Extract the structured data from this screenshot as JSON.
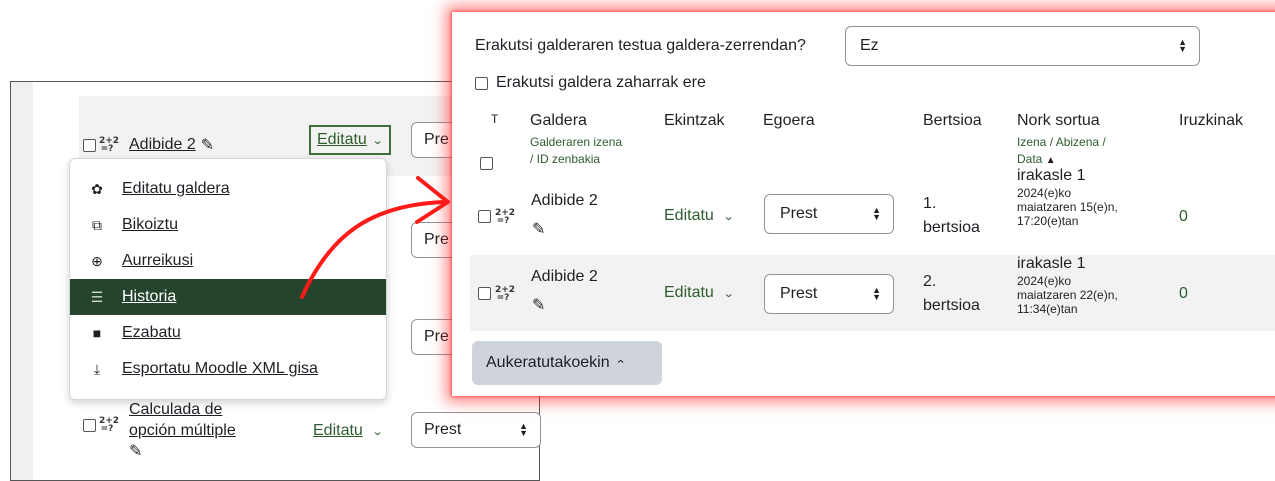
{
  "left": {
    "rows": [
      {
        "name": "Adibide 2",
        "action": "Editatu",
        "status": "Pre"
      },
      {
        "status": "Pre"
      },
      {
        "status": "Pre"
      },
      {
        "name_line1": "Calculada de",
        "name_line2": "opción múltiple",
        "action": "Editatu",
        "status": "Prest"
      }
    ],
    "menu": [
      {
        "icon": "gear-icon",
        "glyph": "✿",
        "label": "Editatu galdera"
      },
      {
        "icon": "copy-icon",
        "glyph": "⧉",
        "label": "Bikoiztu"
      },
      {
        "icon": "zoom-icon",
        "glyph": "⊕",
        "label": "Aurreikusi"
      },
      {
        "icon": "history-icon",
        "glyph": "☰",
        "label": "Historia"
      },
      {
        "icon": "trash-icon",
        "glyph": "🗑",
        "label": "Ezabatu"
      },
      {
        "icon": "download-icon",
        "glyph": "⤓",
        "label": "Esportatu Moodle XML gisa"
      }
    ]
  },
  "popout": {
    "show_text_label": "Erakutsi galderaren testua galdera-zerrendan?",
    "show_text_value": "Ez",
    "show_old_label": "Erakutsi galdera zaharrak ere",
    "headers": {
      "t": "T",
      "question": "Galdera",
      "question_sub1": "Galderaren izena",
      "question_sub2": "/ ID zenbakia",
      "actions": "Ekintzak",
      "status": "Egoera",
      "version": "Bertsioa",
      "created_by": "Nork sortua",
      "created_sub1": "Izena / Abizena /",
      "created_sub2": "Data",
      "comments": "Iruzkinak"
    },
    "rows": [
      {
        "name": "Adibide 2",
        "action": "Editatu",
        "status": "Prest",
        "version_l1": "1.",
        "version_l2": "bertsioa",
        "author": "irakasle 1",
        "date_l1": "2024(e)ko",
        "date_l2": "maiatzaren 15(e)n,",
        "date_l3": "17:20(e)tan",
        "comments": "0"
      },
      {
        "name": "Adibide 2",
        "action": "Editatu",
        "status": "Prest",
        "version_l1": "2.",
        "version_l2": "bertsioa",
        "author": "irakasle 1",
        "date_l1": "2024(e)ko",
        "date_l2": "maiatzaren 22(e)n,",
        "date_l3": "11:34(e)tan",
        "comments": "0"
      }
    ],
    "bulk_label": "Aukeratutakoekin"
  },
  "colors": {
    "accent_green": "#2e5c2e",
    "menu_active": "#24452b",
    "highlight_red": "#ff2828",
    "arrow_red": "#ff1a1a"
  }
}
